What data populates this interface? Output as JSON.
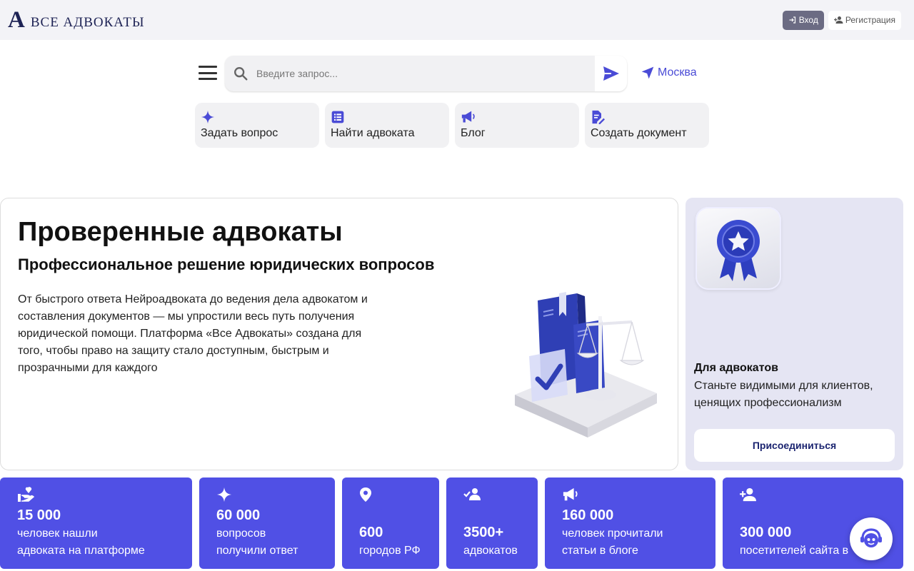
{
  "header": {
    "logo_mark": "A",
    "logo_text": "ВСЕ АДВОКАТЫ",
    "login_label": "Вход",
    "register_label": "Регистрация"
  },
  "search": {
    "placeholder": "Введите запрос...",
    "city": "Москва"
  },
  "quick_actions": [
    {
      "label": "Задать вопрос",
      "icon": "sparkle-icon"
    },
    {
      "label": "Найти адвоката",
      "icon": "list-icon"
    },
    {
      "label": "Блог",
      "icon": "megaphone-icon"
    },
    {
      "label": "Создать документ",
      "icon": "document-edit-icon"
    }
  ],
  "hero": {
    "title": "Проверенные адвокаты",
    "subtitle": "Профессиональное решение юридических вопросов",
    "description": "От быстрого ответа Нейроадвоката до ведения дела адвокатом и составления документов — мы упростили весь путь получения юридической помощи. Платформа «Все Адвокаты» создана для того, чтобы право на защиту стало доступным, быстрым и прозрачными для каждого"
  },
  "side_card": {
    "title": "Для адвокатов",
    "text": "Станьте видимыми для клиентов, ценящих профессионализм",
    "button_label": "Присоединиться"
  },
  "stats": [
    {
      "value": "15 000",
      "line1": "человек нашли",
      "line2": "адвоката на платформе",
      "icon": "hand-heart-icon"
    },
    {
      "value": "60 000",
      "line1": "вопросов",
      "line2": "получили ответ",
      "icon": "sparkle-icon"
    },
    {
      "value": "600",
      "line1": "городов РФ",
      "line2": "",
      "icon": "location-pin-icon"
    },
    {
      "value": "3500+",
      "line1": "адвокатов",
      "line2": "",
      "icon": "users-check-icon"
    },
    {
      "value": "160 000",
      "line1": "человек прочитали",
      "line2": "статьи в блоге",
      "icon": "megaphone-icon"
    },
    {
      "value": "300 000",
      "line1": "посетителей сайта в",
      "line2": "",
      "icon": "person-add-icon"
    }
  ],
  "colors": {
    "accent": "#5050e5",
    "brand_navy": "#1e2355",
    "header_bg": "#f3f3f7",
    "side_card_bg": "#e5e5f3"
  }
}
